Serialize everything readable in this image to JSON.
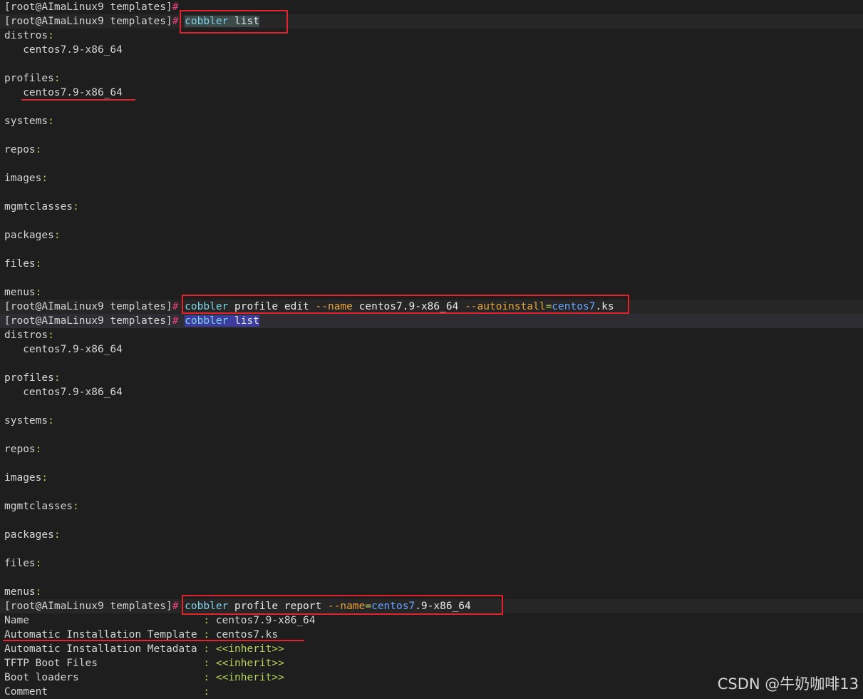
{
  "prompt": {
    "text": "[root@AImaLinux9 templates]",
    "hash": "#"
  },
  "cmd1": {
    "cobbler": "cobbler",
    "list": "list"
  },
  "list1": {
    "distros": "distros",
    "distro_item": "centos7.9-x86_64",
    "profiles": "profiles",
    "profile_item": "centos7.9-x86_64",
    "systems": "systems",
    "repos": "repos",
    "images": "images",
    "mgmtclasses": "mgmtclasses",
    "packages": "packages",
    "files": "files",
    "menus": "menus"
  },
  "cmd2": {
    "cobbler": "cobbler",
    "sub": "profile edit",
    "opt_name": "--name",
    "name_val": "centos7.9-x86_64",
    "opt_auto": "--autoinstall",
    "eq": "=",
    "auto_val": "centos7",
    "auto_ext": ".ks"
  },
  "cmd3": {
    "cobbler": "cobbler",
    "list": "list"
  },
  "list2": {
    "distros": "distros",
    "distro_item": "centos7.9-x86_64",
    "profiles": "profiles",
    "profile_item": "centos7.9-x86_64",
    "systems": "systems",
    "repos": "repos",
    "images": "images",
    "mgmtclasses": "mgmtclasses",
    "packages": "packages",
    "files": "files",
    "menus": "menus"
  },
  "cmd4": {
    "cobbler": "cobbler",
    "sub": "profile report",
    "opt_name": "--name",
    "eq": "=",
    "val_blue": "centos7",
    "val_rest": ".9-x86_64"
  },
  "report": {
    "name_label": "Name                          ",
    "name_val": "centos7.9-x86_64",
    "ait_label": "Automatic Installation Template ",
    "ait_val": "centos7.ks",
    "aim_label": "Automatic Installation Metadata ",
    "aim_val": "<<inherit>>",
    "tftp_label": "TFTP Boot Files               ",
    "tftp_val": "<<inherit>>",
    "boot_label": "Boot loaders                  ",
    "boot_val": "<<inherit>>",
    "comment_label": "Comment                       "
  },
  "watermark": "CSDN @牛奶咖啡13",
  "colors": {
    "highlight_box": "#e0232c",
    "prompt_hash": "#e4427a",
    "command": "#7fd3e8",
    "option": "#e8a43c"
  }
}
